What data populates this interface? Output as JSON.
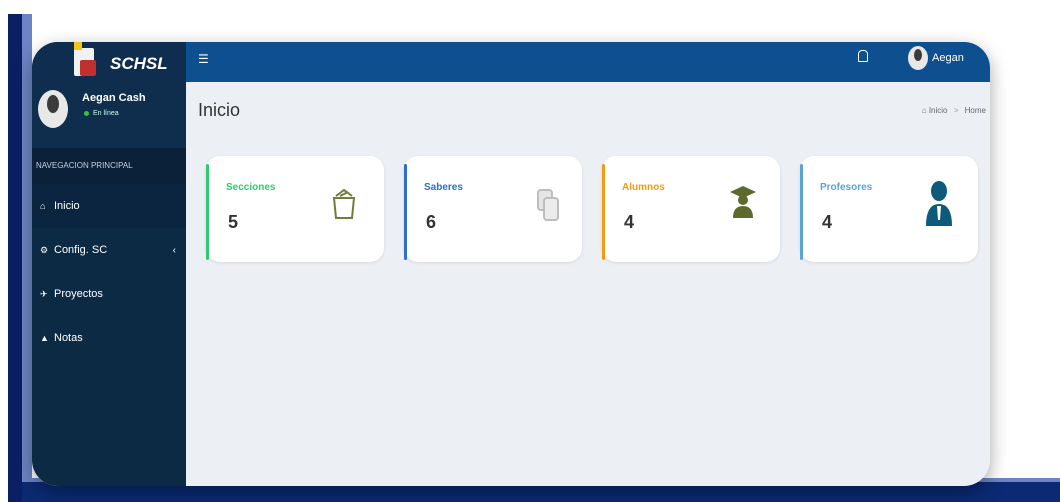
{
  "brand": {
    "name": "SCHSL"
  },
  "user": {
    "name": "Aegan Cash",
    "status": "En línea"
  },
  "topbar": {
    "user_name": "Aegan"
  },
  "sidebar": {
    "header": "NAVEGACION PRINCIPAL",
    "items": [
      {
        "label": "Inicio",
        "icon": "home-icon"
      },
      {
        "label": "Config. SC",
        "icon": "cogs-icon",
        "chevron": "‹"
      },
      {
        "label": "Proyectos",
        "icon": "paper-plane-icon"
      },
      {
        "label": "Notas",
        "icon": "graduation-cap-icon"
      }
    ]
  },
  "page": {
    "title": "Inicio"
  },
  "breadcrumb": {
    "home": "Inicio",
    "current": "Home",
    "separator": ">"
  },
  "cards": [
    {
      "label": "Secciones",
      "value": "5",
      "color": "#2ecc71",
      "icon": "folder-icon"
    },
    {
      "label": "Saberes",
      "value": "6",
      "color": "#2e6fc9",
      "icon": "documents-icon"
    },
    {
      "label": "Alumnos",
      "value": "4",
      "color": "#f39c12",
      "icon": "graduate-icon"
    },
    {
      "label": "Profesores",
      "value": "4",
      "color": "#5ba3d6",
      "icon": "user-tie-icon"
    }
  ],
  "colors": {
    "sidebar": "#0d2a45",
    "topbar": "#0e4f8f",
    "content_bg": "#ecf0f5"
  }
}
